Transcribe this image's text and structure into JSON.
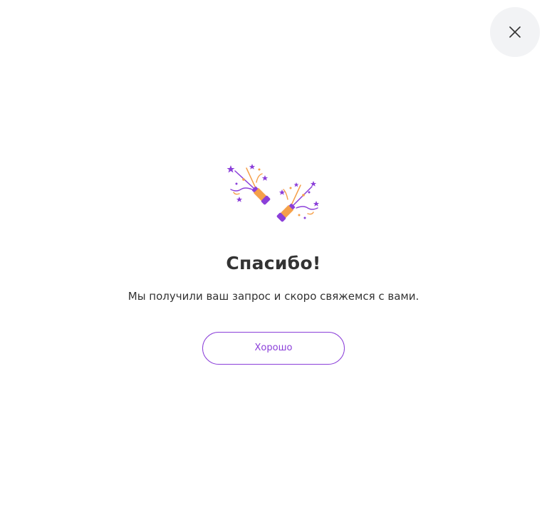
{
  "dialog": {
    "close_icon": "close-icon",
    "illustration_icon": "party-popper-icon",
    "title": "Спасибо!",
    "message": "Мы получили ваш запрос и скоро свяжемся с вами.",
    "ok_label": "Хорошо"
  },
  "colors": {
    "accent": "#8b3fd9",
    "confetti_orange": "#f5a04a",
    "text": "#333333",
    "close_bg": "#f2f3f5"
  }
}
